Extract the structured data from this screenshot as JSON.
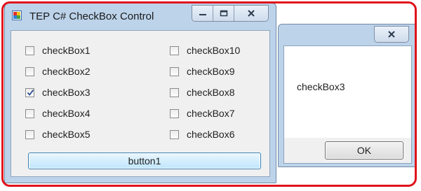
{
  "window": {
    "title": "TEP C# CheckBox Control"
  },
  "checkboxes_left": [
    {
      "label": "checkBox1",
      "checked": false
    },
    {
      "label": "checkBox2",
      "checked": false
    },
    {
      "label": "checkBox3",
      "checked": true
    },
    {
      "label": "checkBox4",
      "checked": false
    },
    {
      "label": "checkBox5",
      "checked": false
    }
  ],
  "checkboxes_right": [
    {
      "label": "checkBox10",
      "checked": false
    },
    {
      "label": "checkBox9",
      "checked": false
    },
    {
      "label": "checkBox8",
      "checked": false
    },
    {
      "label": "checkBox7",
      "checked": false
    },
    {
      "label": "checkBox6",
      "checked": false
    }
  ],
  "button1": {
    "label": "button1"
  },
  "message_box": {
    "text": "checkBox3",
    "ok_label": "OK"
  },
  "colors": {
    "highlight_frame": "#e0121b",
    "window_frame": "#bcd3ea",
    "check_mark": "#2a4d8c"
  },
  "icons": {
    "app": "app-icon",
    "minimize": "minimize-icon",
    "maximize": "maximize-icon",
    "close": "close-icon",
    "check": "check-mark-icon"
  }
}
